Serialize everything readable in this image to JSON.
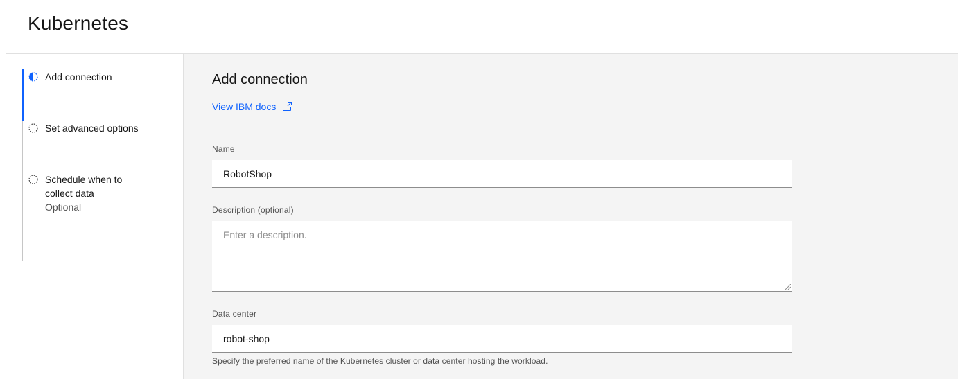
{
  "page": {
    "title": "Kubernetes"
  },
  "progress": {
    "steps": [
      {
        "label": "Add connection",
        "state": "current",
        "optional": ""
      },
      {
        "label": "Set advanced options",
        "state": "incomplete",
        "optional": ""
      },
      {
        "label": "Schedule when to collect data",
        "state": "incomplete",
        "optional": "Optional"
      }
    ]
  },
  "form": {
    "heading": "Add connection",
    "docs_link": "View IBM docs",
    "name": {
      "label": "Name",
      "value": "RobotShop"
    },
    "description": {
      "label": "Description (optional)",
      "placeholder": "Enter a description."
    },
    "data_center": {
      "label": "Data center",
      "value": "robot-shop",
      "helper": "Specify the preferred name of the Kubernetes cluster or data center hosting the workload."
    }
  },
  "colors": {
    "accent": "#0f62fe",
    "panel_bg": "#f4f4f4",
    "text": "#161616",
    "muted": "#525252"
  }
}
